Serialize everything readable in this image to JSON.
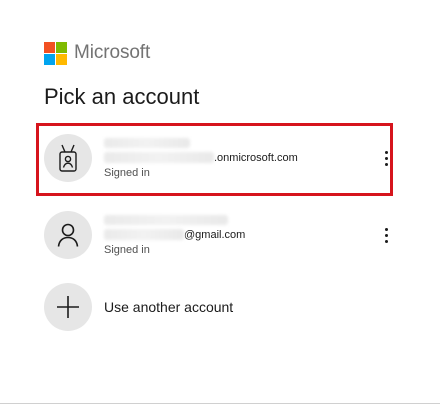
{
  "brand": {
    "name": "Microsoft",
    "logo_colors": [
      "#f25022",
      "#7fba00",
      "#00a4ef",
      "#ffb900"
    ]
  },
  "title": "Pick an account",
  "accounts": [
    {
      "email_suffix": ".onmicrosoft.com",
      "status": "Signed in",
      "icon": "badge-icon",
      "highlighted": true
    },
    {
      "email_suffix": "@gmail.com",
      "status": "Signed in",
      "icon": "person-icon",
      "highlighted": false
    }
  ],
  "add_account": {
    "label": "Use another account",
    "icon": "plus-icon"
  },
  "colors": {
    "highlight": "#d6141c",
    "avatar_bg": "#e6e6e6"
  }
}
